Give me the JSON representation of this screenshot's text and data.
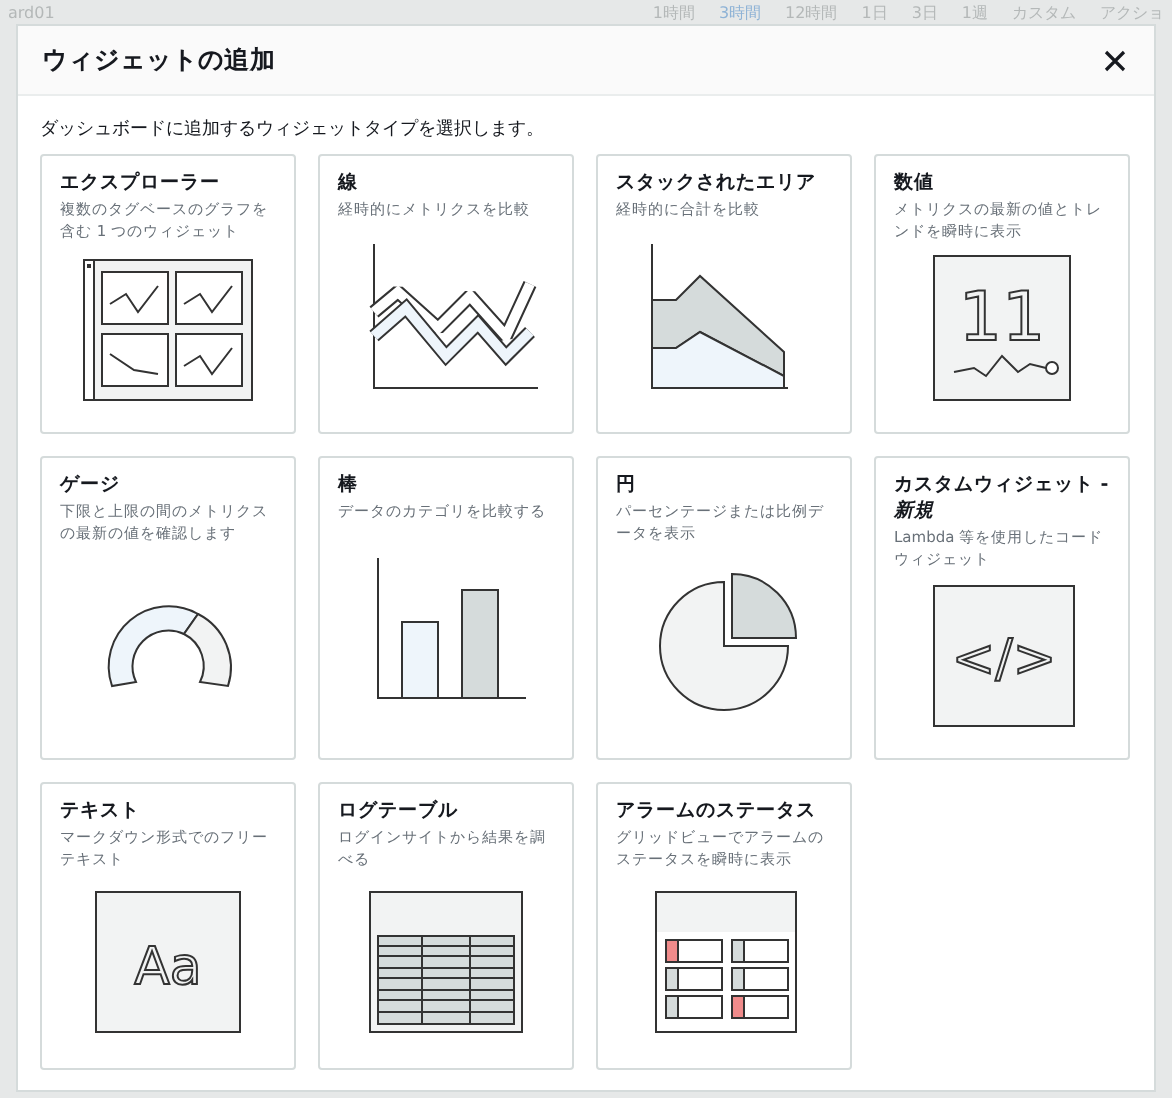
{
  "backdrop": {
    "title": "ard01",
    "time_ranges": [
      {
        "label": "1時間",
        "selected": false
      },
      {
        "label": "3時間",
        "selected": true
      },
      {
        "label": "12時間",
        "selected": false
      },
      {
        "label": "1日",
        "selected": false
      },
      {
        "label": "3日",
        "selected": false
      },
      {
        "label": "1週",
        "selected": false
      },
      {
        "label": "カスタム",
        "selected": false
      }
    ],
    "actions": "アクショ"
  },
  "dialog": {
    "title": "ウィジェットの追加",
    "subtitle": "ダッシュボードに追加するウィジェットタイプを選択します。",
    "widgets": [
      {
        "kind": "explorer",
        "title": "エクスプローラー",
        "description": "複数のタグベースのグラフを含む 1 つのウィジェット"
      },
      {
        "kind": "line",
        "title": "線",
        "description": "経時的にメトリクスを比較"
      },
      {
        "kind": "stacked-area",
        "title": "スタックされたエリア",
        "description": "経時的に合計を比較"
      },
      {
        "kind": "number",
        "title": "数値",
        "description": "メトリクスの最新の値とトレンドを瞬時に表示",
        "icon_text": "11"
      },
      {
        "kind": "gauge",
        "title": "ゲージ",
        "description": "下限と上限の間のメトリクスの最新の値を確認します"
      },
      {
        "kind": "bar",
        "title": "棒",
        "description": "データのカテゴリを比較する"
      },
      {
        "kind": "pie",
        "title": "円",
        "description": "パーセンテージまたは比例データを表示"
      },
      {
        "kind": "custom",
        "title": "カスタムウィジェット - *新規*",
        "description": "Lambda 等を使用したコードウィジェット",
        "icon_text": "</>"
      },
      {
        "kind": "text",
        "title": "テキスト",
        "description": "マークダウン形式でのフリーテキスト",
        "icon_text": "Aa"
      },
      {
        "kind": "log-table",
        "title": "ログテーブル",
        "description": "ログインサイトから結果を調べる"
      },
      {
        "kind": "alarm-status",
        "title": "アラームのステータス",
        "description": "グリッドビューでアラームのステータスを瞬時に表示"
      }
    ]
  }
}
